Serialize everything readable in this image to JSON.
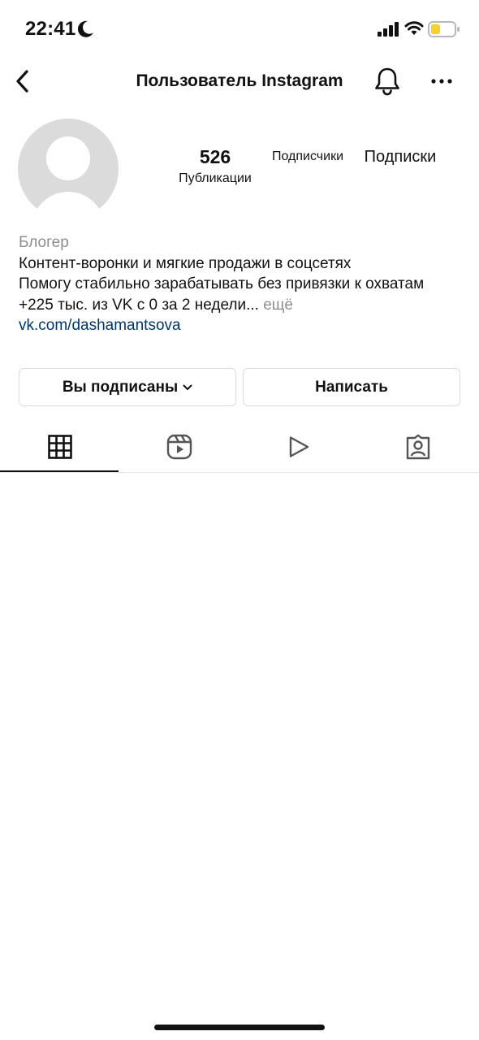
{
  "status_bar": {
    "time": "22:41",
    "icons": [
      "moon-icon",
      "cellular-signal-icon",
      "wifi-icon",
      "battery-icon"
    ],
    "battery_color": "#f5d12e"
  },
  "nav": {
    "title": "Пользователь Instagram",
    "icons": [
      "back-icon",
      "bell-icon",
      "more-icon"
    ]
  },
  "profile": {
    "stats": {
      "posts_count": "526",
      "posts_label": "Публикации",
      "followers_label": "Подписчики",
      "following_label": "Подписки"
    },
    "bio": {
      "category": "Блогер",
      "line1": "Контент-воронки и мягкие продажи в соцсетях",
      "line2": "Помогу стабильно зарабатывать без привязки к охватам",
      "line3": "+225 тыс. из VK с 0 за 2 недели...",
      "more": "ещё",
      "link": "vk.com/dashamantsova"
    }
  },
  "actions": {
    "follow_label": "Вы подписаны",
    "message_label": "Написать"
  },
  "tabs": [
    {
      "icon": "grid-icon",
      "active": true
    },
    {
      "icon": "reels-icon",
      "active": false
    },
    {
      "icon": "video-play-icon",
      "active": false
    },
    {
      "icon": "tagged-icon",
      "active": false
    }
  ],
  "colors": {
    "link": "#00376b",
    "secondary_text": "#8e8e8e",
    "border": "#dbdbdb",
    "avatar_placeholder": "#dbdbdb"
  }
}
